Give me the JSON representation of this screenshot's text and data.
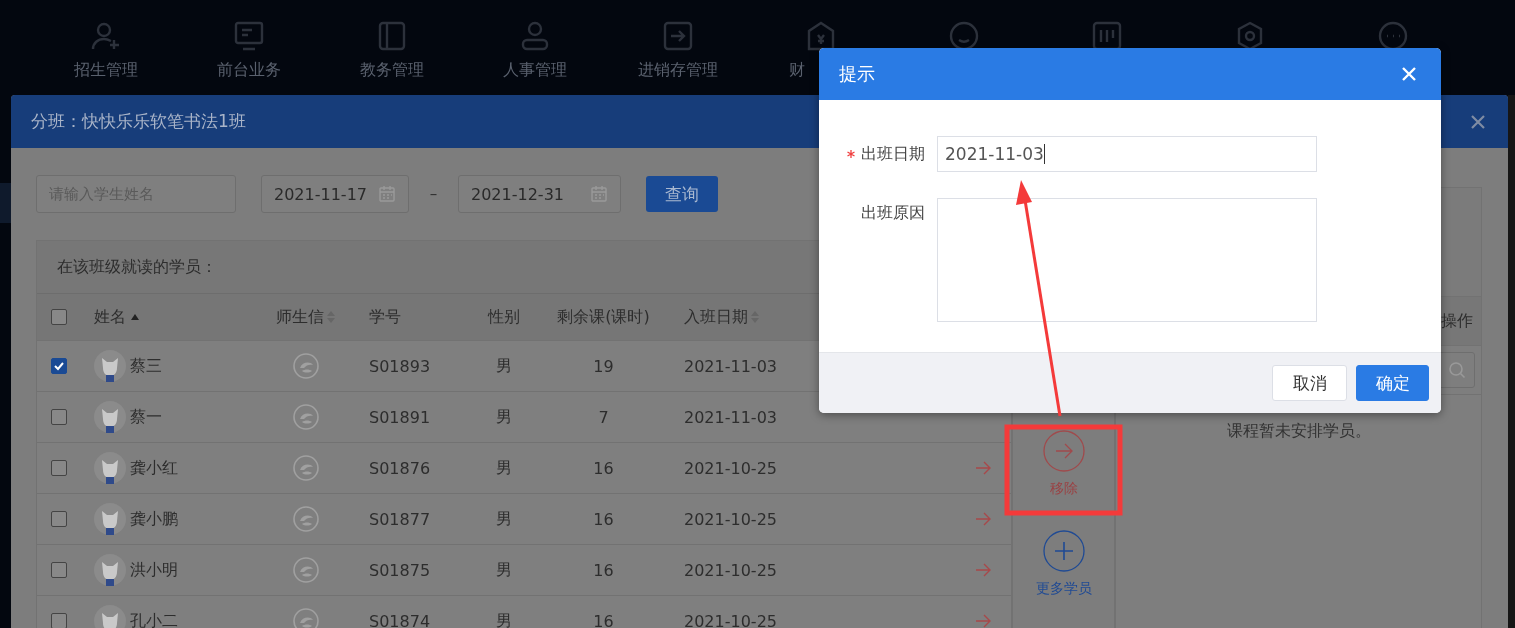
{
  "nav": {
    "items": [
      {
        "label": "招生管理",
        "kind": "person-add"
      },
      {
        "label": "前台业务",
        "kind": "monitor"
      },
      {
        "label": "教务管理",
        "kind": "book"
      },
      {
        "label": "人事管理",
        "kind": "person"
      },
      {
        "label": "进销存管理",
        "kind": "arrow-box"
      },
      {
        "label": "财",
        "kind": "house"
      },
      {
        "kind": "circle"
      },
      {
        "kind": "bars"
      },
      {
        "kind": "hexagon"
      },
      {
        "kind": "dots"
      }
    ]
  },
  "class_modal": {
    "title": "分班：快快乐乐软笔书法1班",
    "search": {
      "placeholder": "请输入学生姓名"
    },
    "date_from": "2021-11-17",
    "separator": "–",
    "date_to": "2021-12-31",
    "query_button": "查询",
    "students": {
      "caption": "在该班级就读的学员：",
      "header_checked": false,
      "columns": [
        {
          "label": "姓名",
          "sortable": true,
          "sorted_ascending": true
        },
        {
          "label": "师生信",
          "sortable": true,
          "sorted_ascending": false
        },
        {
          "label": "学号",
          "sortable": false
        },
        {
          "label": "性别",
          "sortable": false
        },
        {
          "label": "剩余课(课时)",
          "sortable": false
        },
        {
          "label": "入班日期",
          "sortable": true,
          "sorted_ascending": false
        }
      ],
      "rows": [
        {
          "checked": true,
          "name": "蔡三",
          "number": "S01893",
          "gender": "男",
          "remaining": "19",
          "join_date": "2021-11-03",
          "arrow_visible": false
        },
        {
          "checked": false,
          "name": "蔡一",
          "number": "S01891",
          "gender": "男",
          "remaining": "7",
          "join_date": "2021-11-03",
          "arrow_visible": false
        },
        {
          "checked": false,
          "name": "龚小红",
          "number": "S01876",
          "gender": "男",
          "remaining": "16",
          "join_date": "2021-10-25",
          "arrow_visible": true
        },
        {
          "checked": false,
          "name": "龚小鹏",
          "number": "S01877",
          "gender": "男",
          "remaining": "16",
          "join_date": "2021-10-25",
          "arrow_visible": true
        },
        {
          "checked": false,
          "name": "洪小明",
          "number": "S01875",
          "gender": "男",
          "remaining": "16",
          "join_date": "2021-10-25",
          "arrow_visible": true
        },
        {
          "checked": false,
          "name": "孔小二",
          "number": "S01874",
          "gender": "男",
          "remaining": "16",
          "join_date": "2021-10-25",
          "arrow_visible": true
        }
      ]
    },
    "actions": [
      {
        "label": "移除",
        "kind": "remove"
      },
      {
        "label": "更多学员",
        "kind": "add"
      }
    ],
    "course_panel": {
      "column": "操作",
      "empty_text": "课程暂未安排学员。"
    }
  },
  "dialog": {
    "title": "提示",
    "fields": [
      {
        "label": "出班日期",
        "required": true,
        "kind": "input",
        "value": "2021-11-03"
      },
      {
        "label": "出班原因",
        "required": false,
        "kind": "textarea"
      }
    ],
    "buttons": [
      {
        "label": "取消",
        "primary": false
      },
      {
        "label": "确定",
        "primary": true
      }
    ]
  }
}
